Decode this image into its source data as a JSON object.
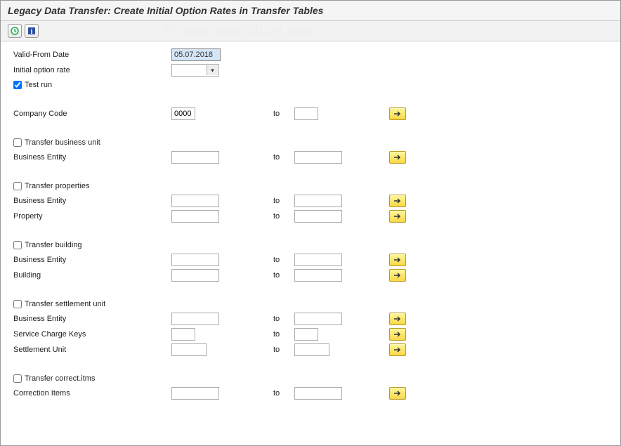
{
  "title": "Legacy Data Transfer: Create Initial Option Rates in Transfer Tables",
  "watermark": "© www.tutorialkart.com",
  "labels": {
    "valid_from": "Valid-From Date",
    "initial_rate": "Initial option rate",
    "test_run": "Test run",
    "company_code": "Company Code",
    "transfer_bu": "Transfer business unit",
    "business_entity": "Business Entity",
    "transfer_props": "Transfer properties",
    "property": "Property",
    "transfer_building": "Transfer building",
    "building": "Building",
    "transfer_su": "Transfer settlement unit",
    "service_charge": "Service Charge Keys",
    "settlement_unit": "Settlement Unit",
    "transfer_ci": "Transfer correct.itms",
    "correction_items": "Correction Items",
    "to": "to"
  },
  "values": {
    "valid_from_date": "05.07.2018",
    "company_code": "0000",
    "test_run_checked": true
  }
}
